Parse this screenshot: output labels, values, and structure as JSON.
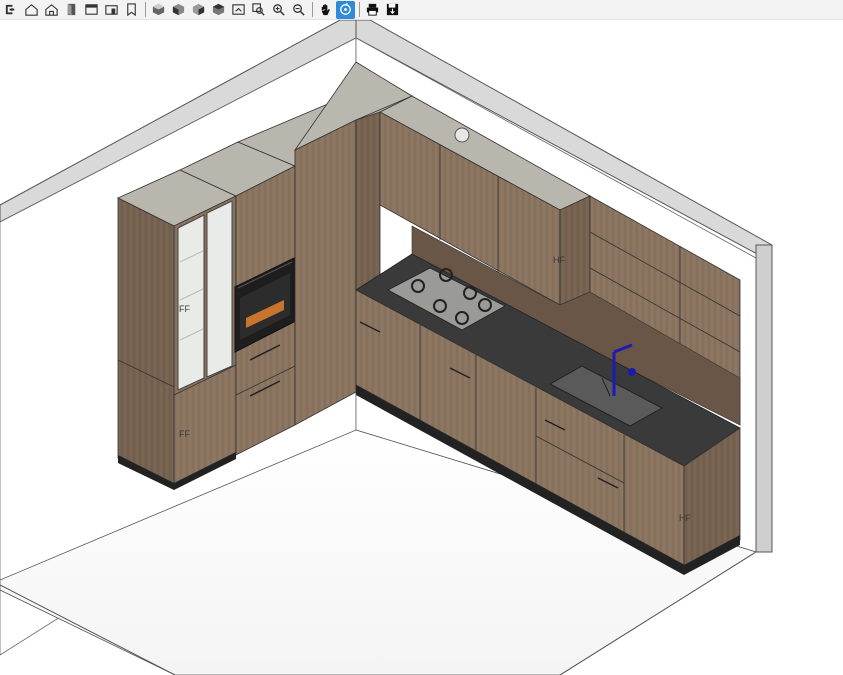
{
  "toolbar": {
    "groups": [
      [
        "exit-icon",
        "home-3d-icon",
        "home-outline-icon",
        "door-icon",
        "wall-front-icon",
        "wall-side-icon",
        "page-icon"
      ],
      [
        "view-iso-1-icon",
        "view-iso-2-icon",
        "view-iso-3-icon",
        "view-iso-4-icon",
        "zoom-extents-icon",
        "zoom-window-icon",
        "zoom-in-icon",
        "zoom-out-icon"
      ],
      [
        "pan-hand-icon",
        "orbit-icon"
      ],
      [
        "print-icon",
        "save-icon"
      ]
    ],
    "active": "orbit-icon",
    "accent": "#2f8bd9"
  },
  "scene": {
    "labels": {
      "tall_glass": "FF",
      "tall_base": "FF",
      "wall_right": "HF",
      "base_right": "HF"
    },
    "colors": {
      "wood": "#8a7460",
      "wood_dark": "#6e5b4a",
      "countertop": "#b9b6ad",
      "worktop_black": "#3a3a3a",
      "wall": "#ffffff",
      "floor": "#ffffff"
    }
  }
}
